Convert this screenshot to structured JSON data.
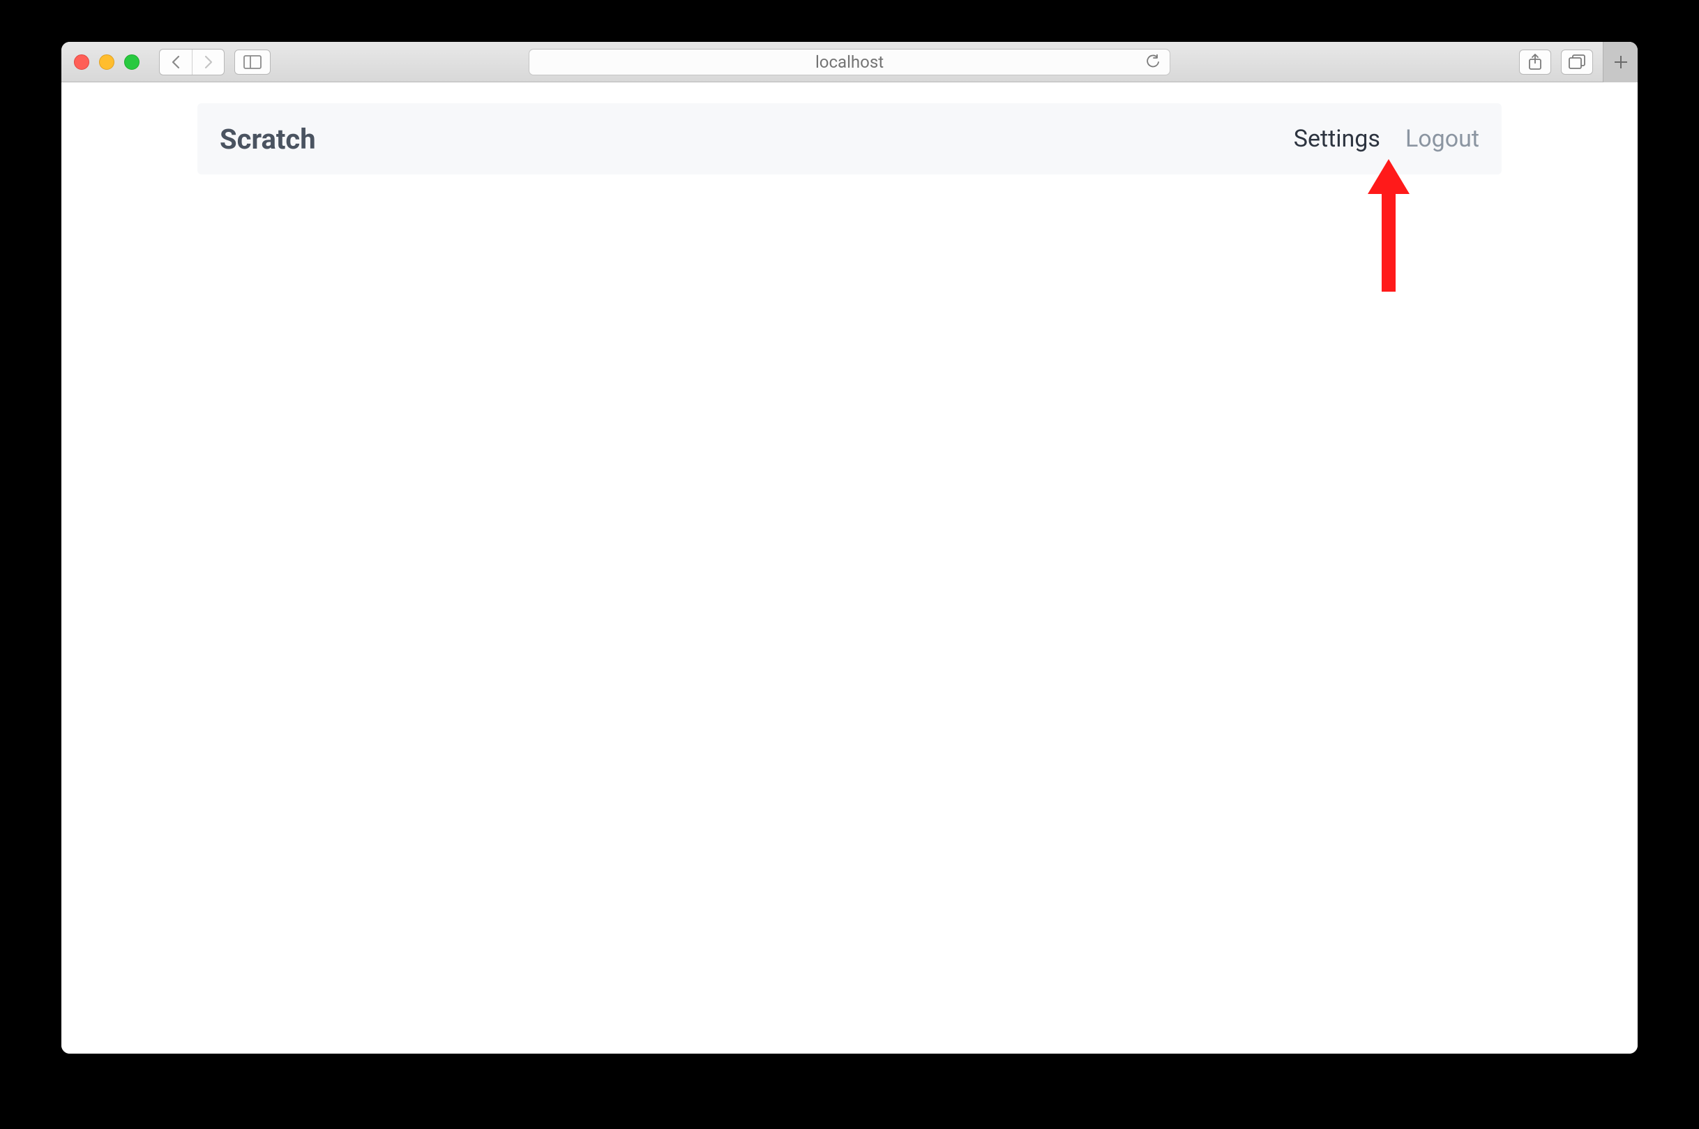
{
  "browser": {
    "address": "localhost"
  },
  "app": {
    "brand": "Scratch",
    "nav": {
      "settings": "Settings",
      "logout": "Logout"
    }
  }
}
